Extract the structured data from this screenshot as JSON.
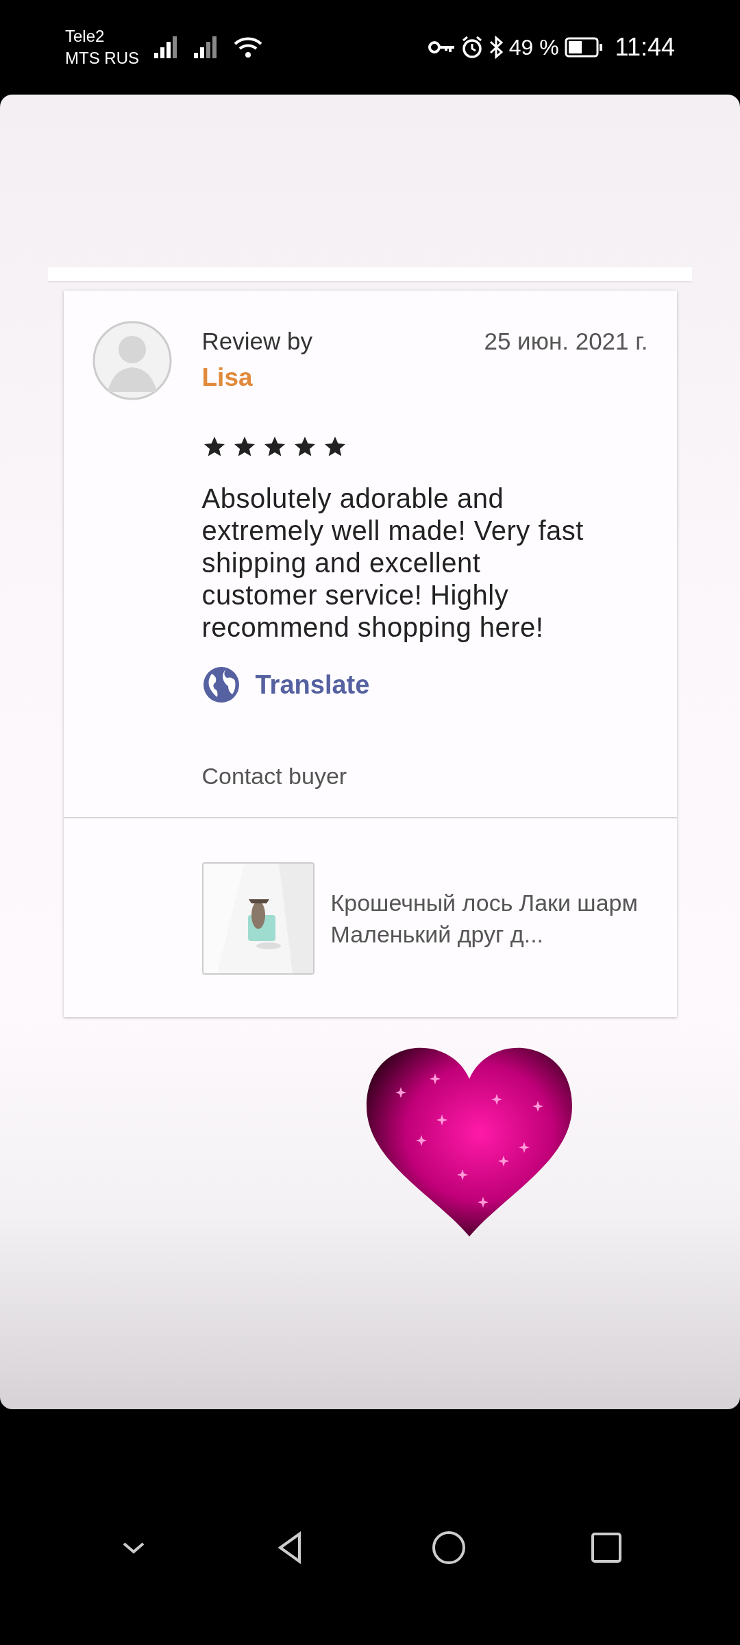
{
  "status_bar": {
    "carriers": [
      "Tele2",
      "MTS RUS"
    ],
    "battery": "49 %",
    "time": "11:44"
  },
  "review": {
    "label": "Review by",
    "author": "Lisa",
    "date": "25 июн. 2021 г.",
    "stars": 5,
    "text": "Absolutely adorable and extremely well made! Very fast shipping and excellent customer service! Highly recommend shopping here!",
    "translate": "Translate",
    "contact": "Contact buyer",
    "product": {
      "title": "Крошечный лось Лаки шарм Маленький друг д..."
    }
  }
}
